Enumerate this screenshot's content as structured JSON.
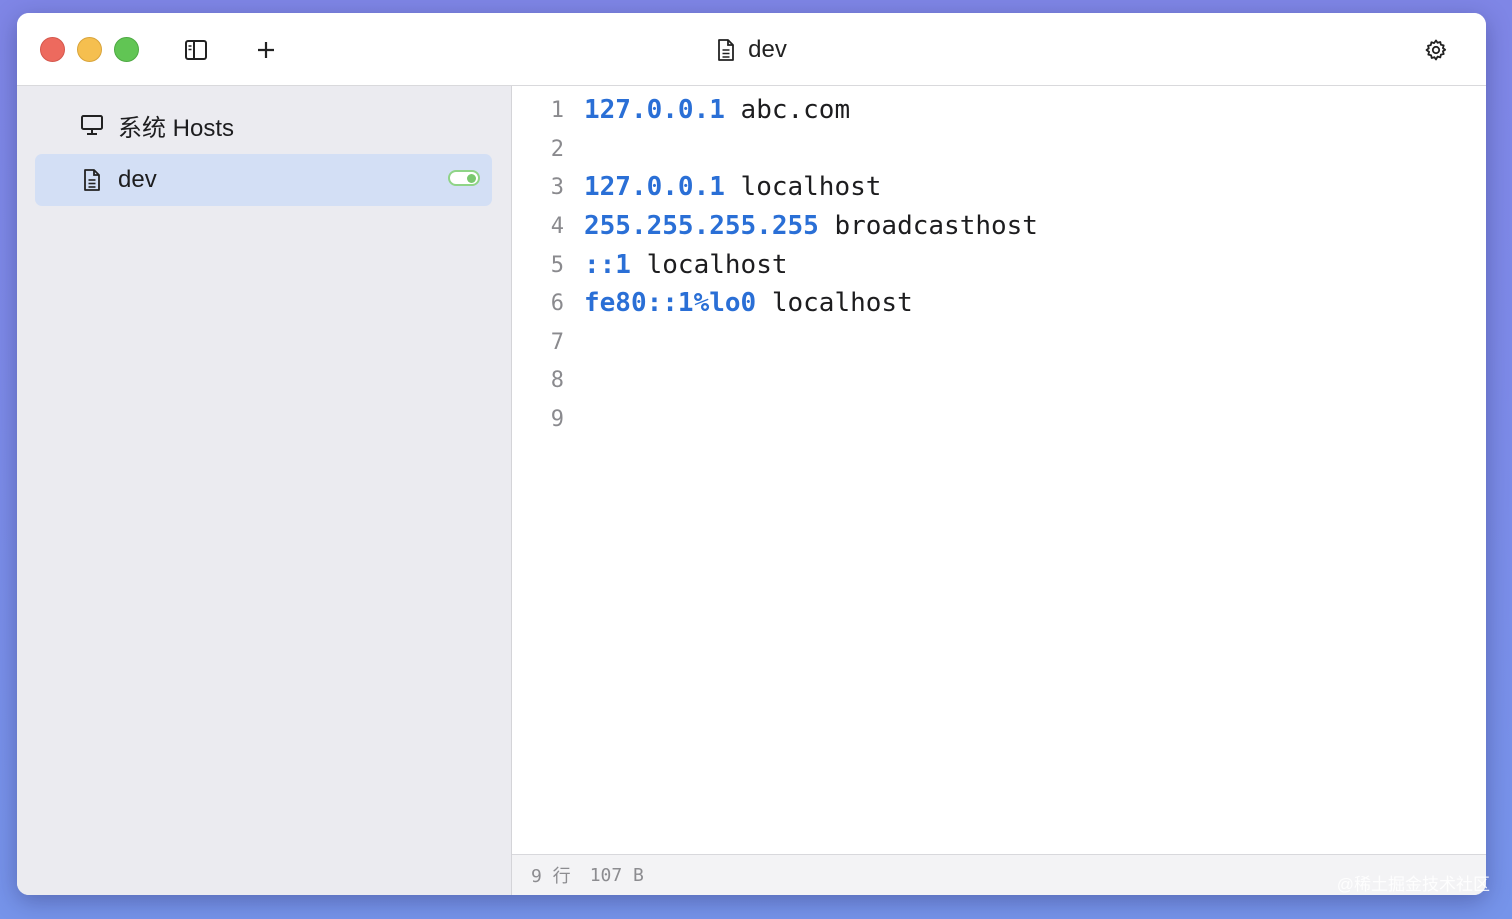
{
  "window": {
    "title": "dev",
    "title_icon": "file-text-icon",
    "toolbar": {
      "sidebar_toggle_icon": "sidebar-toggle-icon",
      "add_icon": "plus-icon",
      "settings_icon": "gear-icon"
    }
  },
  "sidebar": {
    "items": [
      {
        "label": "系统 Hosts",
        "icon": "monitor-icon",
        "selected": false
      },
      {
        "label": "dev",
        "icon": "file-text-icon",
        "selected": true,
        "enabled": true
      }
    ]
  },
  "editor": {
    "lines": [
      {
        "num": "1",
        "ip": "127.0.0.1",
        "host": " abc.com"
      },
      {
        "num": "2",
        "ip": "",
        "host": ""
      },
      {
        "num": "3",
        "ip": "127.0.0.1",
        "host": " localhost"
      },
      {
        "num": "4",
        "ip": "255.255.255.255",
        "host": " broadcasthost"
      },
      {
        "num": "5",
        "ip": "::1",
        "host": " localhost"
      },
      {
        "num": "6",
        "ip": "fe80::1%lo0",
        "host": " localhost"
      },
      {
        "num": "7",
        "ip": "",
        "host": ""
      },
      {
        "num": "8",
        "ip": "",
        "host": ""
      },
      {
        "num": "9",
        "ip": "",
        "host": ""
      }
    ]
  },
  "status": {
    "lines": "9 行",
    "size": "107 B"
  },
  "watermark": "@稀土掘金技术社区",
  "colors": {
    "ip": "#2a6fd6",
    "selected_item": "#d3dff5",
    "toggle_on": "#7ac86f"
  }
}
